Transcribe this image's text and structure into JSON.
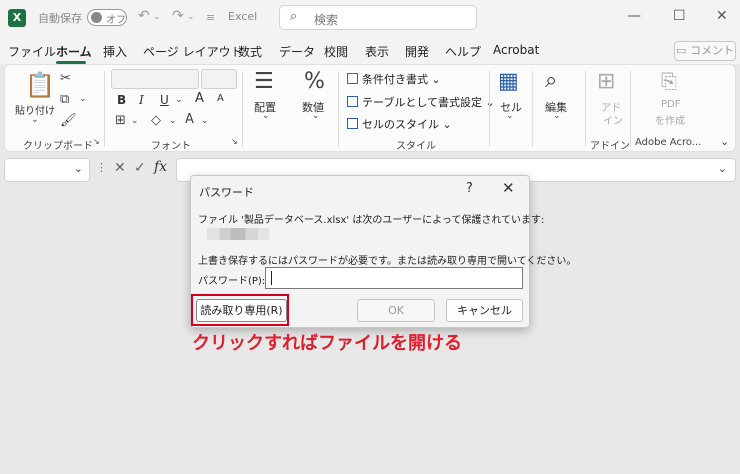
{
  "titlebar": {
    "logo": "X",
    "autosave_label": "自動保存",
    "autosave_state": "オフ",
    "undo_icon": "undo-icon",
    "redo_icon": "redo-icon",
    "customize_icon": "customize-icon",
    "app_name": "Excel",
    "search_placeholder": "検索",
    "minimize": "—",
    "restore": "☐",
    "close": "✕"
  },
  "menubar": {
    "items": [
      "ファイル",
      "ホーム",
      "挿入",
      "ページ レイアウト",
      "数式",
      "データ",
      "校閲",
      "表示",
      "開発",
      "ヘルプ",
      "Acrobat"
    ],
    "active": "ホーム",
    "comment_label": "コメント"
  },
  "ribbon": {
    "clipboard": {
      "paste_label": "貼り付け",
      "group_label": "クリップボード"
    },
    "font": {
      "bold": "B",
      "italic": "I",
      "underline": "U",
      "grow": "A",
      "shrink": "A",
      "group_label": "フォント"
    },
    "alignment": {
      "label": "配置"
    },
    "number": {
      "icon": "%",
      "label": "数値"
    },
    "styles": {
      "conditional": "条件付き書式",
      "table": "テーブルとして書式設定",
      "cell_style": "セルのスタイル",
      "group_label": "スタイル"
    },
    "cells": {
      "label": "セル"
    },
    "editing": {
      "label": "編集"
    },
    "addins": {
      "label_line1": "アド",
      "label_line2": "イン",
      "group_label": "アドイン"
    },
    "pdf": {
      "label_line1": "PDF",
      "label_line2": "を作成",
      "group_label": "Adobe Acro..."
    }
  },
  "formula_bar": {
    "cancel": "✕",
    "enter": "✓",
    "fx": "fx"
  },
  "dialog": {
    "title": "パスワード",
    "help": "?",
    "close": "✕",
    "protected_msg": "ファイル '製品データベース.xlsx' は次のユーザーによって保護されています:",
    "instruction": "上書き保存するにはパスワードが必要です。または読み取り専用で開いてください。",
    "password_label": "パスワード(P):",
    "password_value": "",
    "readonly_button": "読み取り専用(R)",
    "ok_button": "OK",
    "cancel_button": "キャンセル"
  },
  "annotation": {
    "text": "クリックすればファイルを開ける",
    "color": "#e01e2c"
  },
  "colors": {
    "brand": "#1f7244",
    "highlight": "#d4001e"
  }
}
